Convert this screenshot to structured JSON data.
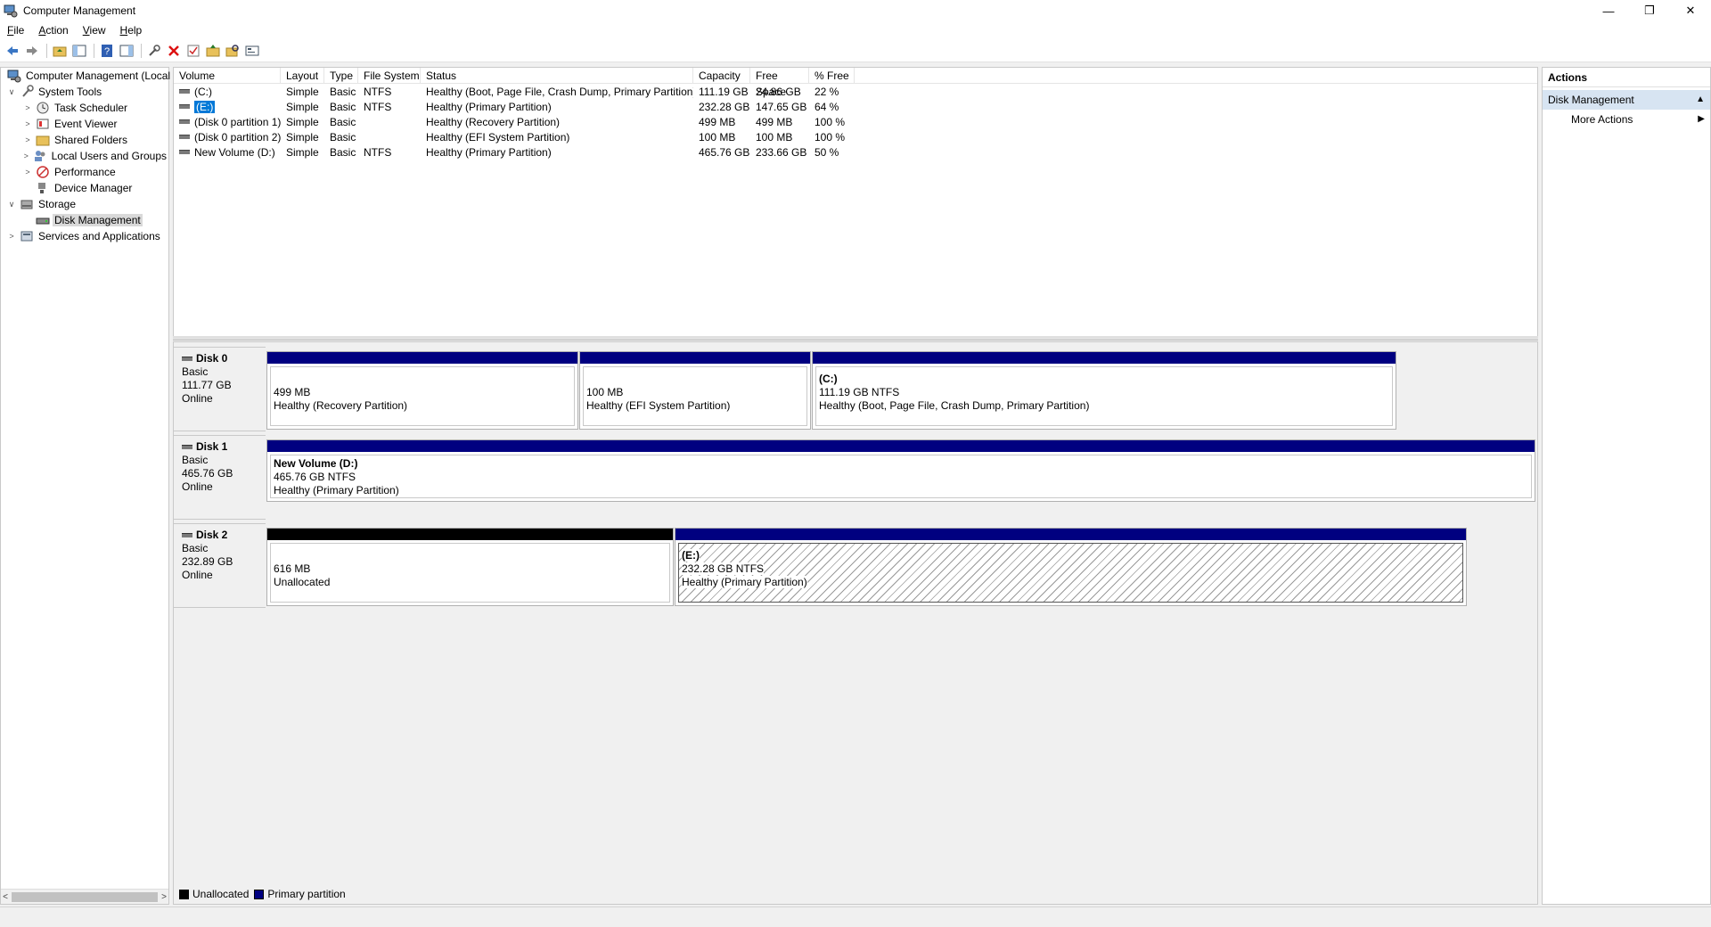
{
  "window": {
    "title": "Computer Management"
  },
  "menu": [
    {
      "label": "File",
      "key": "F",
      "rest": "ile"
    },
    {
      "label": "Action",
      "key": "A",
      "rest": "ction"
    },
    {
      "label": "View",
      "key": "V",
      "rest": "iew"
    },
    {
      "label": "Help",
      "key": "H",
      "rest": "elp"
    }
  ],
  "tree": {
    "root": "Computer Management (Local",
    "system_tools": "System Tools",
    "task_scheduler": "Task Scheduler",
    "event_viewer": "Event Viewer",
    "shared_folders": "Shared Folders",
    "local_users": "Local Users and Groups",
    "performance": "Performance",
    "device_manager": "Device Manager",
    "storage": "Storage",
    "disk_management": "Disk Management",
    "services": "Services and Applications"
  },
  "volume_list": {
    "headers": [
      "Volume",
      "Layout",
      "Type",
      "File System",
      "Status",
      "Capacity",
      "Free Space",
      "% Free"
    ],
    "rows": [
      {
        "volume": "(C:)",
        "layout": "Simple",
        "type": "Basic",
        "fs": "NTFS",
        "status": "Healthy (Boot, Page File, Crash Dump, Primary Partition)",
        "capacity": "111.19 GB",
        "free": "24.86 GB",
        "pct": "22 %"
      },
      {
        "volume": "(E:)",
        "layout": "Simple",
        "type": "Basic",
        "fs": "NTFS",
        "status": "Healthy (Primary Partition)",
        "capacity": "232.28 GB",
        "free": "147.65 GB",
        "pct": "64 %"
      },
      {
        "volume": "(Disk 0 partition 1)",
        "layout": "Simple",
        "type": "Basic",
        "fs": "",
        "status": "Healthy (Recovery Partition)",
        "capacity": "499 MB",
        "free": "499 MB",
        "pct": "100 %"
      },
      {
        "volume": "(Disk 0 partition 2)",
        "layout": "Simple",
        "type": "Basic",
        "fs": "",
        "status": "Healthy (EFI System Partition)",
        "capacity": "100 MB",
        "free": "100 MB",
        "pct": "100 %"
      },
      {
        "volume": "New Volume (D:)",
        "layout": "Simple",
        "type": "Basic",
        "fs": "NTFS",
        "status": "Healthy (Primary Partition)",
        "capacity": "465.76 GB",
        "free": "233.66 GB",
        "pct": "50 %"
      }
    ]
  },
  "disks": [
    {
      "name": "Disk 0",
      "kind": "Basic",
      "size": "111.77 GB",
      "state": "Online",
      "partitions": [
        {
          "name": "",
          "size": "499 MB",
          "status": "Healthy (Recovery Partition)"
        },
        {
          "name": "",
          "size": "100 MB",
          "status": "Healthy (EFI System Partition)"
        },
        {
          "name": "(C:)",
          "size": "111.19 GB NTFS",
          "status": "Healthy (Boot, Page File, Crash Dump, Primary Partition)"
        }
      ]
    },
    {
      "name": "Disk 1",
      "kind": "Basic",
      "size": "465.76 GB",
      "state": "Online",
      "partitions": [
        {
          "name": "New Volume  (D:)",
          "size": "465.76 GB NTFS",
          "status": "Healthy (Primary Partition)"
        }
      ]
    },
    {
      "name": "Disk 2",
      "kind": "Basic",
      "size": "232.89 GB",
      "state": "Online",
      "partitions": [
        {
          "name": "",
          "size": "616 MB",
          "status": "Unallocated"
        },
        {
          "name": "(E:)",
          "size": "232.28 GB NTFS",
          "status": "Healthy (Primary Partition)"
        }
      ]
    }
  ],
  "legend": {
    "unallocated": "Unallocated",
    "primary": "Primary partition"
  },
  "actions": {
    "header": "Actions",
    "section": "Disk Management",
    "more": "More Actions"
  },
  "colors": {
    "primary_partition": "#000080",
    "unallocated": "#000000",
    "selection": "#0078d7",
    "actions_section": "#d7e4f2"
  }
}
